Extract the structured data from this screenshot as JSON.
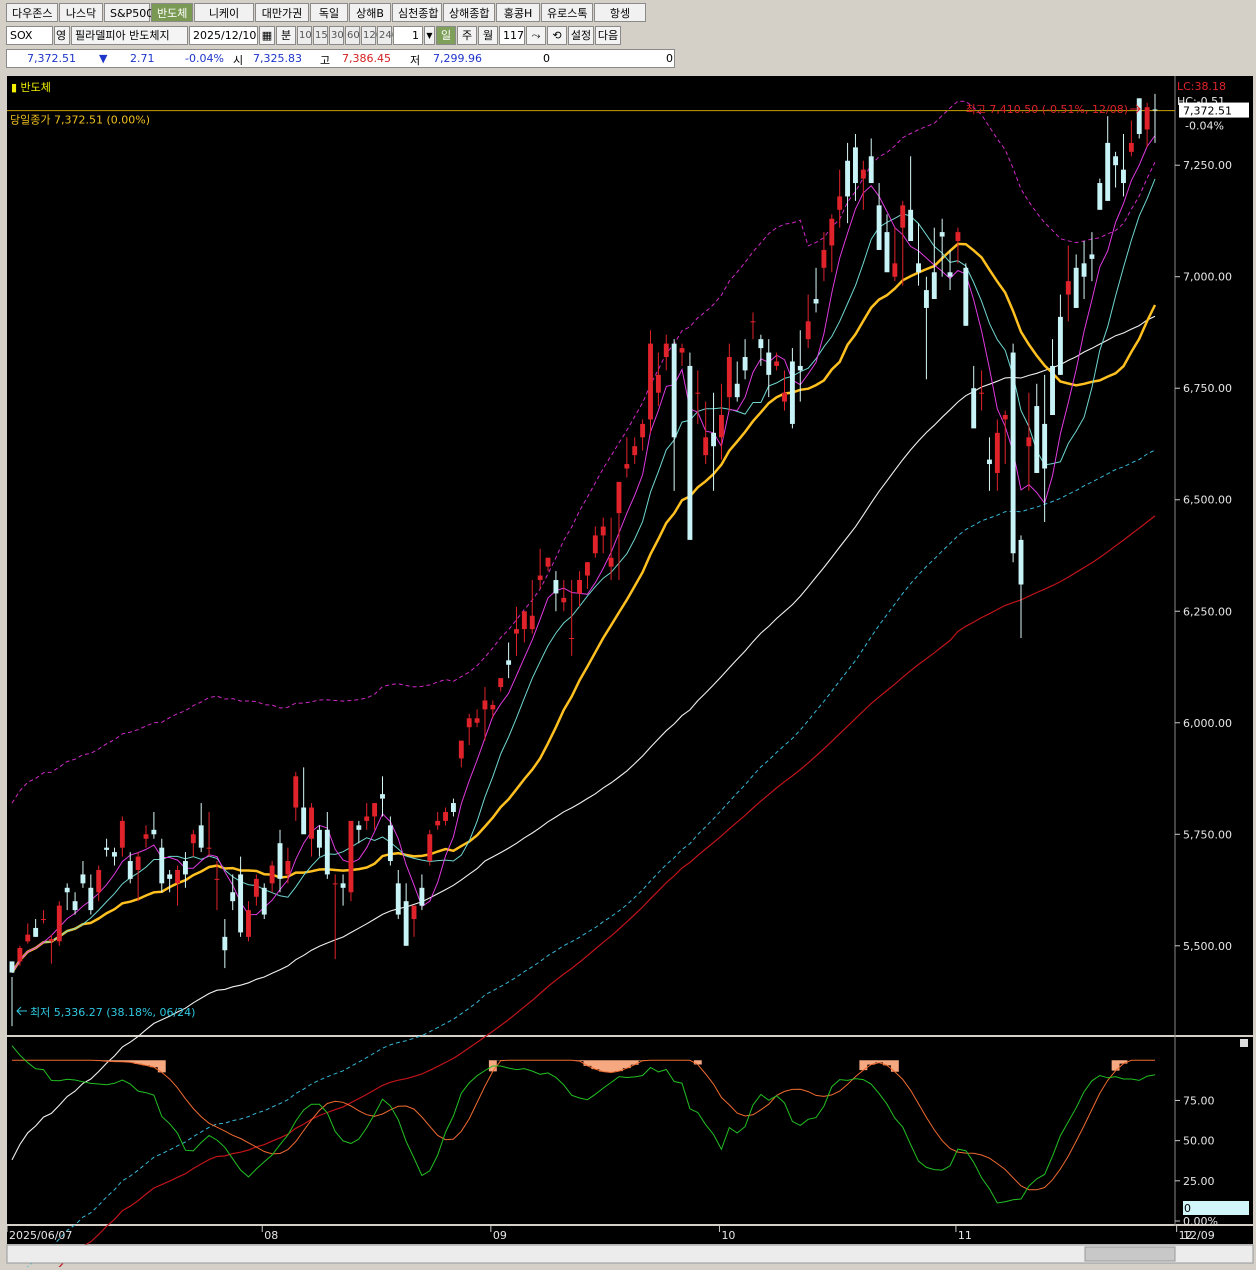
{
  "tabs": [
    "다우존스",
    "나스닥",
    "S&P500",
    "반도체",
    "니케이",
    "대만가권",
    "독일",
    "상해B",
    "심천종합",
    "상해종합",
    "홍콩H",
    "유로스톡",
    "항셍"
  ],
  "active_tab": 3,
  "toolbar": {
    "code": "SOX",
    "lang": "영",
    "name": "필라델피아 반도체지",
    "date": "2025/12/10",
    "minute_label": "분",
    "intervals": [
      "10",
      "15",
      "30",
      "60",
      "120",
      "240"
    ],
    "count": "1",
    "day": "일",
    "week": "주",
    "month": "월",
    "bars": "117",
    "settings": "설정",
    "next": "다음"
  },
  "quote": {
    "price": "7,372.51",
    "arrow": "▼",
    "change": "2.71",
    "pct": "-0.04%",
    "open_label": "시",
    "open": "7,325.83",
    "high_label": "고",
    "high": "7,386.45",
    "low_label": "저",
    "low": "7,299.96",
    "v1": "0",
    "v2": "0"
  },
  "chart_data": {
    "type": "candlestick",
    "title": "반도체",
    "close_label": "당일종가 7,372.51 (0.00%)",
    "high_annotation": "최고 7,410.50 (-0.51%, 12/08)",
    "low_annotation": "최저 5,336.27 (38.18%, 06/24)",
    "lc_label": "LC:38.18",
    "hc_label": "HC:-0.51",
    "last_price": "7,372.51",
    "last_pct": "-0.04%",
    "y_ticks": [
      "7,250.00",
      "7,000.00",
      "6,750.00",
      "6,500.00",
      "6,250.00",
      "6,000.00",
      "5,750.00",
      "5,500.00"
    ],
    "y_tick_values": [
      7250,
      7000,
      6750,
      6500,
      6250,
      6000,
      5750,
      5500
    ],
    "ylim": [
      5300,
      7450
    ],
    "x_labels": [
      "2025/06/07",
      "08",
      "09",
      "10",
      "11",
      "12"
    ],
    "x_label_bars": [
      2,
      32,
      61,
      90,
      120,
      148
    ],
    "last_date_label": "12/09",
    "candles": [
      [
        5465,
        5430,
        5320,
        5440
      ],
      [
        5465,
        5500,
        5455,
        5495
      ],
      [
        5510,
        5550,
        5505,
        5525
      ],
      [
        5540,
        5560,
        5520,
        5520
      ],
      [
        5560,
        5580,
        5550,
        5560
      ],
      [
        5510,
        5525,
        5460,
        5515
      ],
      [
        5510,
        5600,
        5500,
        5590
      ],
      [
        5630,
        5640,
        5580,
        5620
      ],
      [
        5600,
        5620,
        5570,
        5580
      ],
      [
        5660,
        5690,
        5630,
        5640
      ],
      [
        5630,
        5660,
        5570,
        5580
      ],
      [
        5620,
        5680,
        5600,
        5670
      ],
      [
        5720,
        5740,
        5700,
        5715
      ],
      [
        5710,
        5720,
        5680,
        5700
      ],
      [
        5720,
        5790,
        5700,
        5780
      ],
      [
        5690,
        5710,
        5640,
        5650
      ],
      [
        5670,
        5710,
        5600,
        5700
      ],
      [
        5740,
        5770,
        5720,
        5750
      ],
      [
        5760,
        5800,
        5740,
        5750
      ],
      [
        5720,
        5740,
        5620,
        5640
      ],
      [
        5660,
        5670,
        5620,
        5650
      ],
      [
        5640,
        5680,
        5590,
        5670
      ],
      [
        5690,
        5710,
        5630,
        5660
      ],
      [
        5730,
        5760,
        5700,
        5750
      ],
      [
        5770,
        5820,
        5710,
        5720
      ],
      [
        5720,
        5800,
        5700,
        5720
      ],
      [
        5650,
        5690,
        5580,
        5650
      ],
      [
        5520,
        5560,
        5450,
        5490
      ],
      [
        5620,
        5660,
        5580,
        5600
      ],
      [
        5660,
        5700,
        5520,
        5530
      ],
      [
        5520,
        5600,
        5510,
        5580
      ],
      [
        5610,
        5660,
        5590,
        5650
      ],
      [
        5630,
        5640,
        5560,
        5570
      ],
      [
        5640,
        5690,
        5620,
        5680
      ],
      [
        5730,
        5760,
        5620,
        5650
      ],
      [
        5660,
        5720,
        5640,
        5690
      ],
      [
        5810,
        5890,
        5780,
        5880
      ],
      [
        5810,
        5900,
        5780,
        5750
      ],
      [
        5740,
        5820,
        5700,
        5810
      ],
      [
        5760,
        5770,
        5700,
        5720
      ],
      [
        5760,
        5800,
        5650,
        5660
      ],
      [
        5640,
        5660,
        5470,
        5640
      ],
      [
        5640,
        5660,
        5590,
        5630
      ],
      [
        5620,
        5780,
        5600,
        5780
      ],
      [
        5770,
        5780,
        5730,
        5760
      ],
      [
        5780,
        5820,
        5760,
        5790
      ],
      [
        5790,
        5820,
        5760,
        5820
      ],
      [
        5840,
        5880,
        5790,
        5830
      ],
      [
        5770,
        5790,
        5680,
        5690
      ],
      [
        5640,
        5670,
        5560,
        5570
      ],
      [
        5600,
        5640,
        5500,
        5500
      ],
      [
        5560,
        5590,
        5520,
        5590
      ],
      [
        5630,
        5660,
        5580,
        5590
      ],
      [
        5690,
        5760,
        5680,
        5750
      ],
      [
        5770,
        5800,
        5760,
        5780
      ],
      [
        5780,
        5810,
        5770,
        5800
      ],
      [
        5820,
        5830,
        5790,
        5800
      ],
      [
        5920,
        5960,
        5900,
        5960
      ],
      [
        5990,
        6020,
        5950,
        6010
      ],
      [
        6000,
        6030,
        5990,
        6010
      ],
      [
        6030,
        6080,
        5960,
        6050
      ],
      [
        6030,
        6050,
        6010,
        6040
      ],
      [
        6080,
        6100,
        6070,
        6100
      ],
      [
        6140,
        6180,
        6100,
        6130
      ],
      [
        6200,
        6260,
        6150,
        6210
      ],
      [
        6210,
        6250,
        6180,
        6250
      ],
      [
        6210,
        6320,
        6200,
        6240
      ],
      [
        6320,
        6390,
        6300,
        6330
      ],
      [
        6350,
        6370,
        6340,
        6370
      ],
      [
        6320,
        6340,
        6250,
        6290
      ],
      [
        6270,
        6320,
        6250,
        6280
      ],
      [
        6190,
        6320,
        6150,
        6190
      ],
      [
        6290,
        6340,
        6260,
        6320
      ],
      [
        6330,
        6360,
        6300,
        6360
      ],
      [
        6380,
        6440,
        6370,
        6420
      ],
      [
        6420,
        6460,
        6380,
        6440
      ],
      [
        6350,
        6460,
        6320,
        6370
      ],
      [
        6470,
        6540,
        6320,
        6540
      ],
      [
        6570,
        6640,
        6550,
        6580
      ],
      [
        6600,
        6640,
        6580,
        6620
      ],
      [
        6640,
        6680,
        6610,
        6670
      ],
      [
        6680,
        6880,
        6650,
        6850
      ],
      [
        6740,
        6830,
        6710,
        6780
      ],
      [
        6820,
        6870,
        6790,
        6850
      ],
      [
        6850,
        6860,
        6520,
        6640
      ],
      [
        6830,
        6850,
        6800,
        6840
      ],
      [
        6800,
        6830,
        6560,
        6410
      ],
      [
        6740,
        6790,
        6670,
        6740
      ],
      [
        6600,
        6720,
        6580,
        6640
      ],
      [
        6650,
        6740,
        6520,
        6620
      ],
      [
        6640,
        6760,
        6590,
        6690
      ],
      [
        6730,
        6850,
        6700,
        6820
      ],
      [
        6760,
        6810,
        6720,
        6730
      ],
      [
        6820,
        6860,
        6770,
        6790
      ],
      [
        6900,
        6920,
        6860,
        6900
      ],
      [
        6860,
        6870,
        6800,
        6840
      ],
      [
        6830,
        6860,
        6730,
        6780
      ],
      [
        6800,
        6830,
        6790,
        6810
      ],
      [
        6720,
        6790,
        6700,
        6740
      ],
      [
        6810,
        6840,
        6660,
        6670
      ],
      [
        6800,
        6880,
        6720,
        6790
      ],
      [
        6860,
        6960,
        6840,
        6900
      ],
      [
        6950,
        7020,
        6920,
        6940
      ],
      [
        7020,
        7100,
        6990,
        7060
      ],
      [
        7070,
        7140,
        7010,
        7130
      ],
      [
        7150,
        7240,
        7110,
        7180
      ],
      [
        7260,
        7300,
        7120,
        7180
      ],
      [
        7290,
        7320,
        7170,
        7210
      ],
      [
        7220,
        7260,
        7150,
        7240
      ],
      [
        7270,
        7310,
        7240,
        7210
      ],
      [
        7160,
        7210,
        7070,
        7060
      ],
      [
        7100,
        7140,
        7030,
        7010
      ],
      [
        7000,
        7110,
        6990,
        7030
      ],
      [
        7110,
        7170,
        6980,
        7160
      ],
      [
        7150,
        7270,
        7090,
        7080
      ],
      [
        7030,
        7120,
        6980,
        7010
      ],
      [
        6970,
        7000,
        6770,
        6930
      ],
      [
        7010,
        7110,
        6950,
        6950
      ],
      [
        7100,
        7130,
        7000,
        7090
      ],
      [
        7010,
        7060,
        6970,
        7000
      ],
      [
        7080,
        7110,
        7030,
        7100
      ],
      [
        7020,
        7030,
        6890,
        6890
      ],
      [
        6750,
        6800,
        6680,
        6660
      ],
      [
        6740,
        6790,
        6700,
        6740
      ],
      [
        6590,
        6640,
        6520,
        6580
      ],
      [
        6560,
        6680,
        6520,
        6650
      ],
      [
        6680,
        6700,
        6580,
        6690
      ],
      [
        6830,
        6850,
        6360,
        6380
      ],
      [
        6410,
        6420,
        6190,
        6310
      ],
      [
        6620,
        6740,
        6520,
        6640
      ],
      [
        6710,
        6760,
        6560,
        6560
      ],
      [
        6670,
        6780,
        6450,
        6570
      ],
      [
        6800,
        6860,
        6690,
        6690
      ],
      [
        6910,
        6960,
        6780,
        6780
      ],
      [
        6960,
        7070,
        6900,
        6990
      ],
      [
        7020,
        7050,
        6930,
        6930
      ],
      [
        7030,
        7080,
        6950,
        7000
      ],
      [
        7050,
        7100,
        6990,
        7040
      ],
      [
        7210,
        7220,
        7160,
        7150
      ],
      [
        7300,
        7360,
        7170,
        7170
      ],
      [
        7270,
        7280,
        7200,
        7250
      ],
      [
        7240,
        7320,
        7180,
        7210
      ],
      [
        7280,
        7350,
        7270,
        7300
      ],
      [
        7400,
        7400,
        7310,
        7320
      ],
      [
        7330,
        7390,
        7290,
        7380
      ],
      [
        7375,
        7410,
        7300,
        7373
      ]
    ],
    "ma_note": "moving averages and envelope bands derived from candle closes",
    "osc_ticks": [
      "75.00",
      "50.00",
      "25.00",
      "0.00%"
    ],
    "osc_tick_values": [
      75,
      50,
      25,
      0
    ],
    "osc_marker": "0"
  }
}
